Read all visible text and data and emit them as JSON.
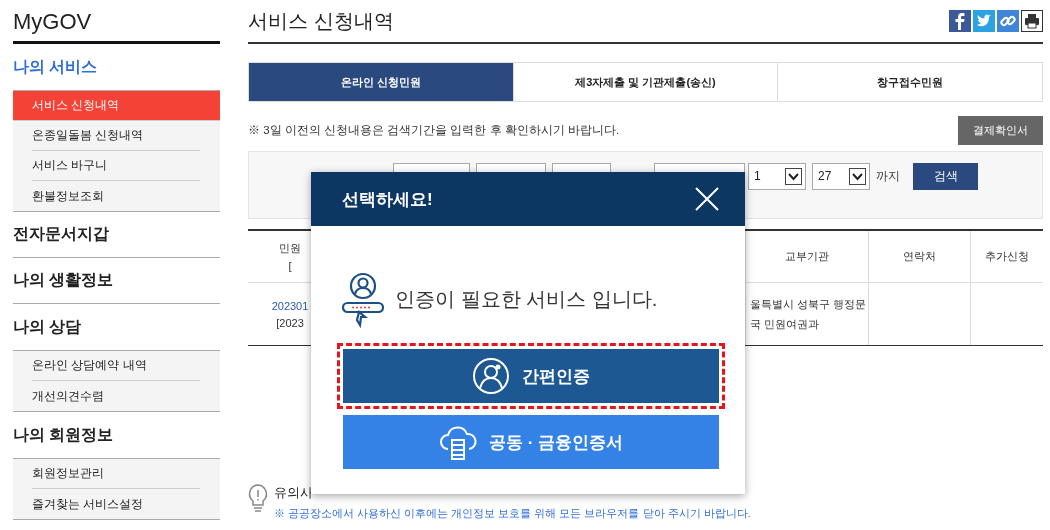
{
  "sidebar": {
    "logo": "MyGOV",
    "sections": [
      {
        "title": "나의 서비스",
        "selected": true,
        "items": [
          {
            "label": "서비스 신청내역",
            "selected": true
          },
          {
            "label": "온종일돌봄 신청내역",
            "selected": false
          },
          {
            "label": "서비스 바구니",
            "selected": false
          },
          {
            "label": "환불정보조회",
            "selected": false
          }
        ]
      },
      {
        "title": "전자문서지갑",
        "selected": false
      },
      {
        "title": "나의 생활정보",
        "selected": false
      },
      {
        "title": "나의 상담",
        "selected": false,
        "items": [
          {
            "label": "온라인 상담예약 내역",
            "selected": false
          },
          {
            "label": "개선의견수렴",
            "selected": false
          }
        ]
      },
      {
        "title": "나의 회원정보",
        "selected": false,
        "items": [
          {
            "label": "회원정보관리",
            "selected": false
          },
          {
            "label": "즐겨찾는 서비스설정",
            "selected": false
          }
        ]
      }
    ]
  },
  "page_title": "서비스 신청내역",
  "tabs": [
    {
      "label": "온라인 신청민원",
      "selected": true
    },
    {
      "label": "제3자제출 및 기관제출(송신)",
      "selected": false
    },
    {
      "label": "창구접수민원",
      "selected": false
    }
  ],
  "notice": "※ 3일 이전의 신청내용은 검색기간을 입력한 후 확인하시기 바랍니다.",
  "receipt_button": "결제확인서",
  "search": {
    "selects": [
      {
        "value": "1"
      },
      {
        "value": "27"
      }
    ],
    "until_label": "까지",
    "button": "검색"
  },
  "table": {
    "columns": [
      {
        "lines": [
          "민원",
          "["
        ]
      },
      {
        "lines": [
          "교부기관"
        ]
      },
      {
        "lines": [
          "연락처"
        ]
      },
      {
        "lines": [
          "추가신청"
        ]
      }
    ],
    "rows": [
      {
        "column_1": [
          "202301",
          "[2023"
        ],
        "agency": [
          "울특별시 성북구 행정문",
          "국 민원여권과"
        ]
      }
    ]
  },
  "caution": {
    "title": "유의사",
    "text": "※ 공공장소에서 사용하신 이후에는 개인정보 보호를 위해 모든 브라우저를 닫아 주시기 바랍니다."
  },
  "modal": {
    "title": "선택하세요!",
    "message": "인증이 필요한 서비스 입니다.",
    "buttons": [
      {
        "label": "간편인증",
        "kind": "simple",
        "highlighted": true
      },
      {
        "label": "공동 · 금융인증서",
        "kind": "certificate",
        "highlighted": false
      }
    ]
  }
}
